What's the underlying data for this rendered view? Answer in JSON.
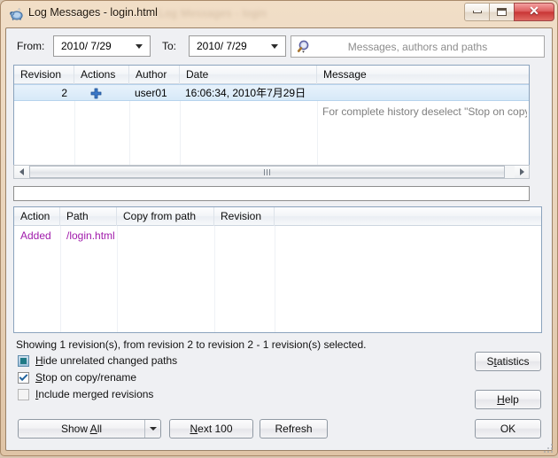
{
  "window": {
    "title": "Log Messages - login.html",
    "ghost_text": "Log Messages  -  login",
    "icon": "tortoisesvn-turtle-icon",
    "controls": {
      "minimize": "–",
      "maximize": "□",
      "close": "✕"
    },
    "colors": {
      "titlebar_top": "#f1dec7",
      "titlebar_bottom": "#dfc4a6",
      "frame_border": "#a98a6a",
      "dialog_bg": "#eff0f3",
      "close_button": "#c93636",
      "selection": "#d7e9f8",
      "added_text": "#a01bab"
    }
  },
  "toolbar": {
    "from_label": "From:",
    "from_value": "2010/ 7/29",
    "to_label": "To:",
    "to_value": "2010/ 7/29",
    "search_icon": "magnifier-icon",
    "search_placeholder": "Messages, authors and paths"
  },
  "revision_list": {
    "columns": [
      "Revision",
      "Actions",
      "Author",
      "Date",
      "Message"
    ],
    "rows": [
      {
        "revision": "2",
        "action_icon": "added-plus-icon",
        "author": "user01",
        "date": "16:06:34, 2010年7月29日",
        "message": "",
        "selected": true
      }
    ],
    "message_hint": "For complete history deselect \"Stop on copy/renam"
  },
  "commit_message": {
    "value": ""
  },
  "path_list": {
    "columns": [
      "Action",
      "Path",
      "Copy from path",
      "Revision"
    ],
    "rows": [
      {
        "action": "Added",
        "path": "/login.html",
        "copy_from_path": "",
        "revision": ""
      }
    ]
  },
  "status": {
    "text": "Showing 1 revision(s), from revision 2 to revision 2 - 1 revision(s) selected."
  },
  "options": [
    {
      "label": "Hide unrelated changed paths",
      "accel": "H",
      "state": "mixed"
    },
    {
      "label": "Stop on copy/rename",
      "accel": "S",
      "state": "checked"
    },
    {
      "label": "Include merged revisions",
      "accel": "I",
      "state": "unchecked"
    }
  ],
  "buttons": {
    "show_all": "Show All",
    "show_all_accel": "A",
    "next_100": "Next 100",
    "next_100_accel": "N",
    "refresh": "Refresh",
    "statistics": "Statistics",
    "statistics_accel": "t",
    "help": "Help",
    "help_accel": "H",
    "ok": "OK"
  },
  "scrollbar": {
    "left_arrow": "◀",
    "right_arrow": "▶"
  }
}
